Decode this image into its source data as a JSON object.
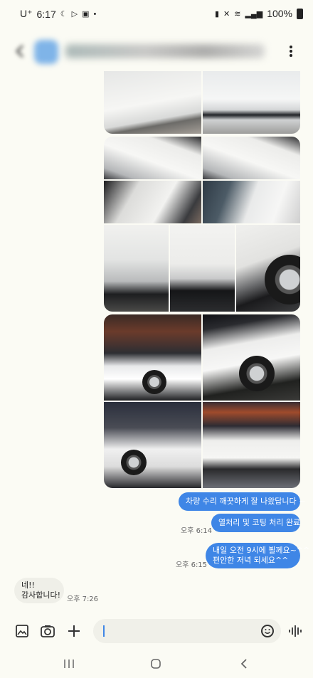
{
  "status_bar": {
    "carrier": "U⁺",
    "time": "6:17",
    "battery": "100%"
  },
  "header": {
    "title": "(blurred contact name)"
  },
  "messages": [
    {
      "direction": "out",
      "text": "차량 수리 깨끗하게 잘 나왔답니다 ~"
    },
    {
      "direction": "out",
      "text": "열처리 및 코팅 처리 완료",
      "time": "오후 6:14"
    },
    {
      "direction": "out",
      "lines": [
        "내일 오전 9시에 뵐께요~^^",
        "편안한 저녁 되세요^^"
      ],
      "time": "오후 6:15"
    },
    {
      "direction": "in",
      "lines": [
        "네!!",
        "감사합니다!"
      ],
      "time": "오후 7:26"
    }
  ],
  "composer": {
    "placeholder": ""
  },
  "icons": {
    "gallery": "image-icon",
    "camera": "camera-icon",
    "add": "plus-icon",
    "emoji": "smiley-icon",
    "voice": "voice-wave-icon"
  }
}
